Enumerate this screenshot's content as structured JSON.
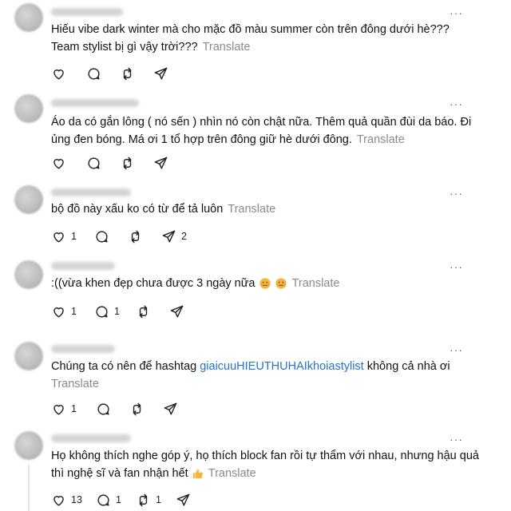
{
  "comments": [
    {
      "text": "Hiếu vibe dark winter mà cho mặc đồ màu summer còn trên đông dưới hè??? Team stylist bị gì vậy trời???",
      "translate": "Translate",
      "likes": "",
      "replies": "",
      "reposts": "",
      "shares": ""
    },
    {
      "text": "Áo da có gắn lông ( nó sến ) nhìn nó còn chật nữa. Thêm quả quần đùi da báo. Đi ủng đen bóng. Má ơi 1 tổ hợp trên đông giữ hè dưới đông.",
      "translate": "Translate",
      "likes": "",
      "replies": "",
      "reposts": "",
      "shares": ""
    },
    {
      "text": "bộ đồ này xấu ko có từ để tả luôn",
      "translate": "Translate",
      "likes": "1",
      "replies": "",
      "reposts": "",
      "shares": "2"
    },
    {
      "text": ":((vừa khen đẹp chưa được 3 ngày nữa",
      "translate": "Translate",
      "likes": "1",
      "replies": "1",
      "reposts": "",
      "shares": ""
    },
    {
      "text_before": "Chúng ta có nên để hashtag ",
      "hashtag": "giaicuuHIEUTHUHAIkhoiastylist",
      "text_after": " không cả nhà ơi",
      "translate": "Translate",
      "likes": "1",
      "replies": "",
      "reposts": "",
      "shares": ""
    },
    {
      "text": "Họ không thích nghe góp ý, họ thích block fan rồi tự thẩm với nhau, nhưng hậu quả thì nghệ sĩ và fan nhận hết",
      "translate": "Translate",
      "likes": "13",
      "replies": "1",
      "reposts": "1",
      "shares": ""
    }
  ],
  "more_label": "···",
  "icons": [
    "heart-icon",
    "comment-icon",
    "repost-icon",
    "share-icon",
    "more-icon",
    "sad-face-emoji",
    "thumbs-up-emoji"
  ],
  "colors": {
    "hashtag": "#2774c8",
    "translate": "#8a8a8a",
    "text": "#111111"
  }
}
